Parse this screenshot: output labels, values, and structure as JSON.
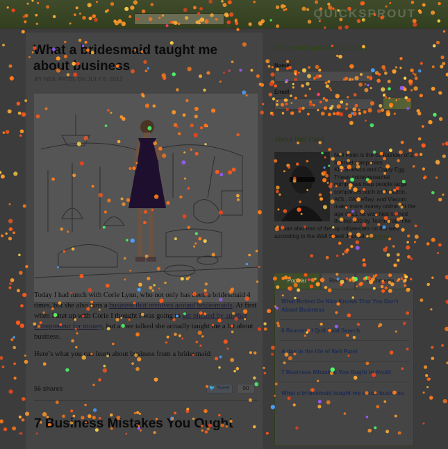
{
  "header": {
    "logo": "QUICKSPROUT",
    "search_placeholder": ""
  },
  "post": {
    "title": "What a bridesmaid taught me about business",
    "meta": "BY NEIL PATEL ON JULY 6, 2012",
    "body_p1_a": "Today I had lunch with Corie Lynn, who not only has been a bridesmaid 4 times, but she also runs a ",
    "body_p1_link1": "business that revolves around bridesmaids",
    "body_p1_b": ". At first when I met up with Corie I thought I was going to ",
    "body_p1_link2": "get pitched by another entrepreneur for money",
    "body_p1_c": ", but as we talked she actually taught me a lot about business.",
    "body_p2": "Here’s what you can learn about business from a bridesmaid:",
    "shares": "56 shares",
    "tweet_label": "Tweet",
    "tweet_count": "90"
  },
  "next_post": {
    "title": "7 Business Mistakes You Ought"
  },
  "sidebar": {
    "email_heading": "Get email updates (it’s free)",
    "name_label": "Name:",
    "email_label": "Email:",
    "submit_label": "",
    "about_heading": "About Neil Patel",
    "bio": "Neil Patel is the co-founder of 2 Internet companies: KISSmetrics and Crazy Egg. These entrepreneurial companies help people large companies such as Amazon, AOL, GM, eBay, and Viacom make more money online. At the age of 21 he was Neil named the top 100 by Technorati. The he was also one of the top influencers on the web according to the Wall Street Journal.",
    "bio_link": "Continue",
    "tabs": [
      "Popular",
      "Recent",
      "Comments"
    ],
    "popular_posts": [
      "What Robert De Niro Knows That You Don't About Business",
      "6 Reasons I Quit Paid Search",
      "A day in the life of Neil Patel",
      "7 Business Mistakes You Ought to Avoid",
      "What a bridesmaid taught me about business"
    ]
  },
  "colors": {
    "overlay": "#3c3c3c",
    "brand_green": "#33401f",
    "link_navy": "#1e2c52"
  }
}
